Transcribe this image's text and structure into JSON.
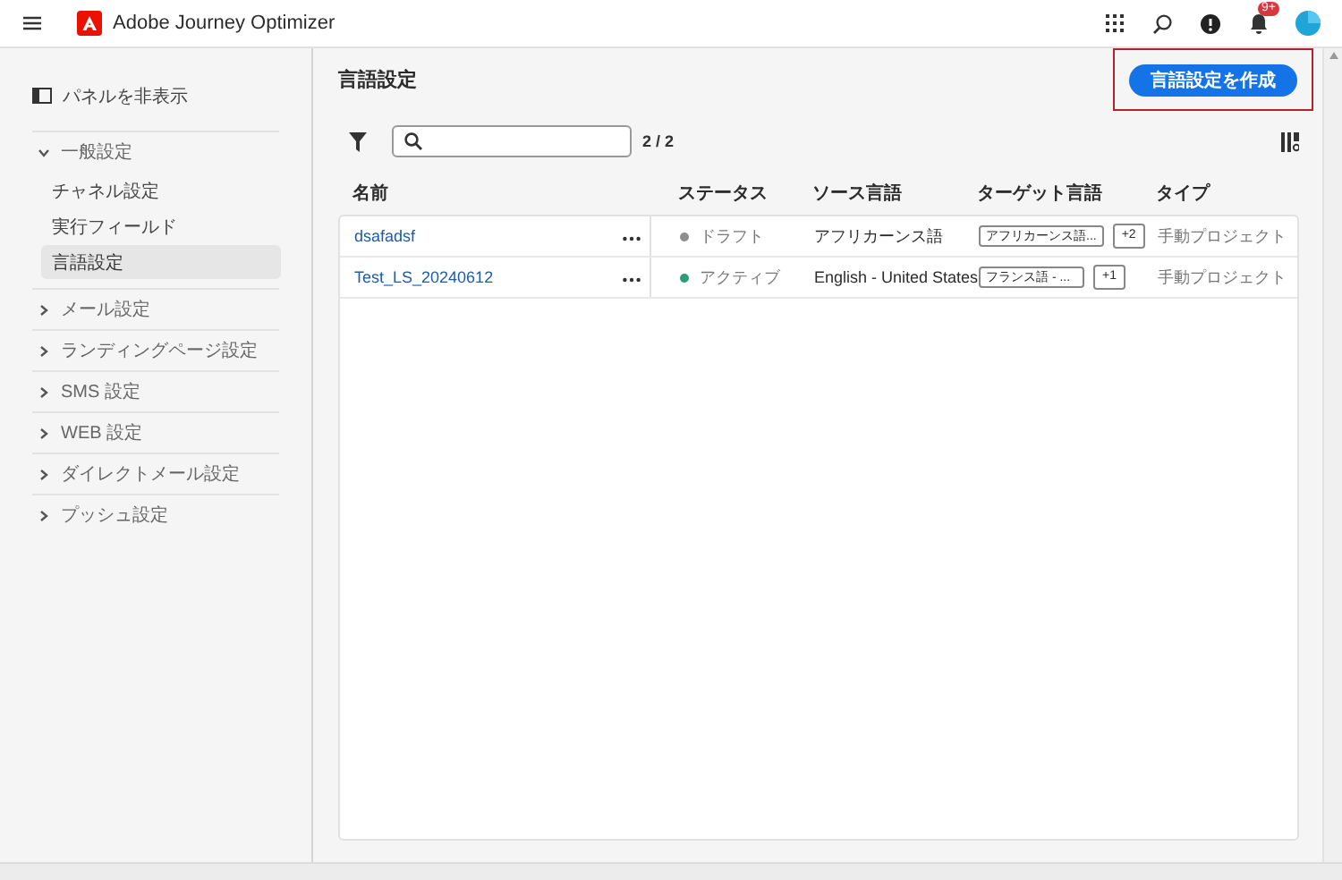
{
  "header": {
    "app_title": "Adobe Journey Optimizer",
    "notification_badge": "9+"
  },
  "sidebar": {
    "toggle_label": "パネルを非表示",
    "sections": [
      {
        "label": "一般設定",
        "expanded": true,
        "items": [
          {
            "label": "チャネル設定",
            "selected": false
          },
          {
            "label": "実行フィールド",
            "selected": false
          },
          {
            "label": "言語設定",
            "selected": true
          }
        ]
      },
      {
        "label": "メール設定",
        "expanded": false
      },
      {
        "label": "ランディングページ設定",
        "expanded": false
      },
      {
        "label": "SMS 設定",
        "expanded": false
      },
      {
        "label": "WEB 設定",
        "expanded": false
      },
      {
        "label": "ダイレクトメール設定",
        "expanded": false
      },
      {
        "label": "プッシュ設定",
        "expanded": false
      }
    ]
  },
  "page": {
    "title": "言語設定",
    "create_button": "言語設定を作成",
    "count": "2 / 2"
  },
  "table": {
    "columns": [
      "名前",
      "ステータス",
      "ソース言語",
      "ターゲット言語",
      "タイプ"
    ],
    "rows": [
      {
        "name": "dsafadsf",
        "status": "ドラフト",
        "color": "#8e8e8e",
        "source": "アフリカーンス語",
        "target": "アフリカーンス語...",
        "extra": "+2",
        "type": "手動プロジェクト"
      },
      {
        "name": "Test_LS_20240612",
        "status": "アクティブ",
        "color": "#2d9d78",
        "source": "English - United States",
        "target": "フランス語 - ...",
        "extra": "+1",
        "type": "手動プロジェクト"
      }
    ]
  }
}
